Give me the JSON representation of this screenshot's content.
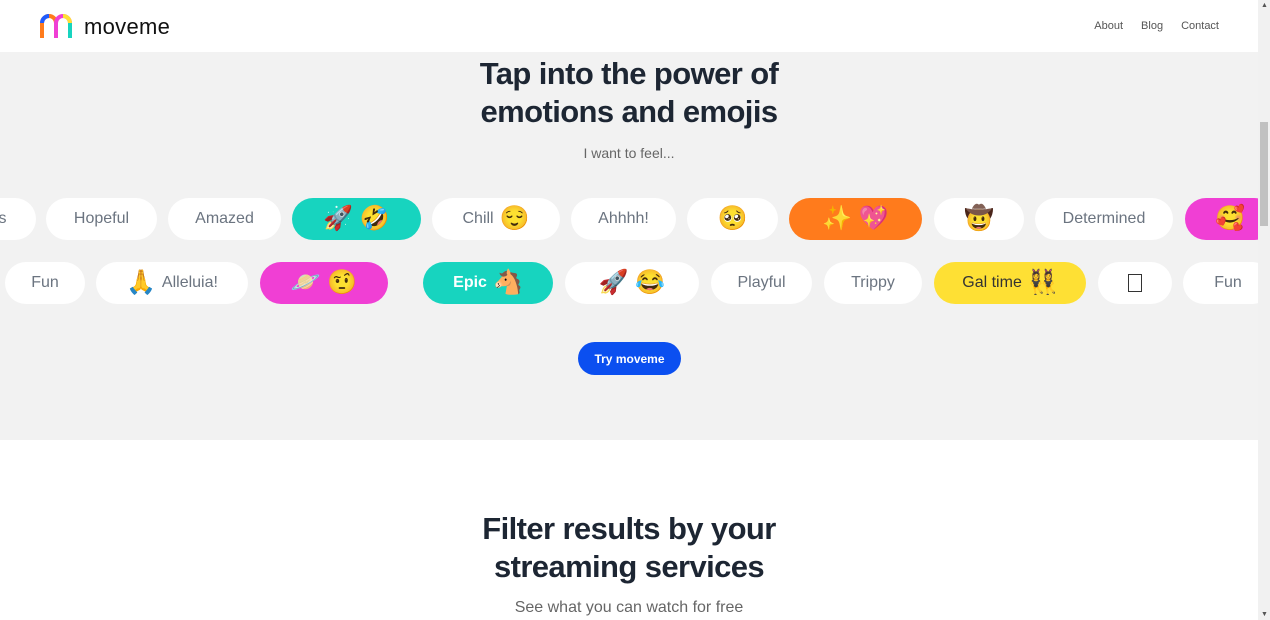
{
  "header": {
    "brand": "moveme",
    "nav": [
      "About",
      "Blog",
      "Contact"
    ]
  },
  "hero": {
    "title_line1": "Tap into the power of",
    "title_line2": "emotions and emojis",
    "subtitle": "I want to feel...",
    "cta": "Try moveme",
    "row1": [
      {
        "label": "es",
        "emoji": "",
        "color": "white"
      },
      {
        "label": "Hopeful",
        "emoji": "",
        "color": "white"
      },
      {
        "label": "Amazed",
        "emoji": "",
        "color": "white"
      },
      {
        "label": "",
        "emoji": "🚀 🤣",
        "color": "teal"
      },
      {
        "label": "Chill",
        "emoji": "😌",
        "color": "white"
      },
      {
        "label": "Ahhhh!",
        "emoji": "",
        "color": "white"
      },
      {
        "label": "",
        "emoji": "🥺",
        "color": "white"
      },
      {
        "label": "",
        "emoji": "✨ 💖",
        "color": "orange"
      },
      {
        "label": "",
        "emoji": "🤠",
        "color": "white"
      },
      {
        "label": "Determined",
        "emoji": "",
        "color": "white"
      },
      {
        "label": "",
        "emoji": "🥰",
        "color": "pink"
      }
    ],
    "row2": [
      {
        "label": "Fun",
        "emoji": "",
        "color": "white"
      },
      {
        "label": "Alleluia!",
        "emoji": "🙏",
        "color": "white",
        "emoji_first": true
      },
      {
        "label": "",
        "emoji": "🪐 🤨",
        "color": "pink"
      },
      {
        "label": "Epic",
        "emoji": "🐴",
        "color": "teal"
      },
      {
        "label": "",
        "emoji": "🚀 😂",
        "color": "white"
      },
      {
        "label": "Playful",
        "emoji": "",
        "color": "white"
      },
      {
        "label": "Trippy",
        "emoji": "",
        "color": "white"
      },
      {
        "label": "Gal time",
        "emoji": "👯‍♀️",
        "color": "yellow"
      },
      {
        "label": "",
        "emoji": "box",
        "color": "white"
      },
      {
        "label": "Fun",
        "emoji": "",
        "color": "white"
      }
    ]
  },
  "streaming": {
    "title_line1": "Filter results by your",
    "title_line2": "streaming services",
    "subtitle": "See what you can watch for free"
  },
  "colors": {
    "teal": "#17d4bf",
    "pink": "#f03fd4",
    "orange": "#ff7b1c",
    "yellow": "#fee034",
    "cta": "#0b4ff0"
  }
}
